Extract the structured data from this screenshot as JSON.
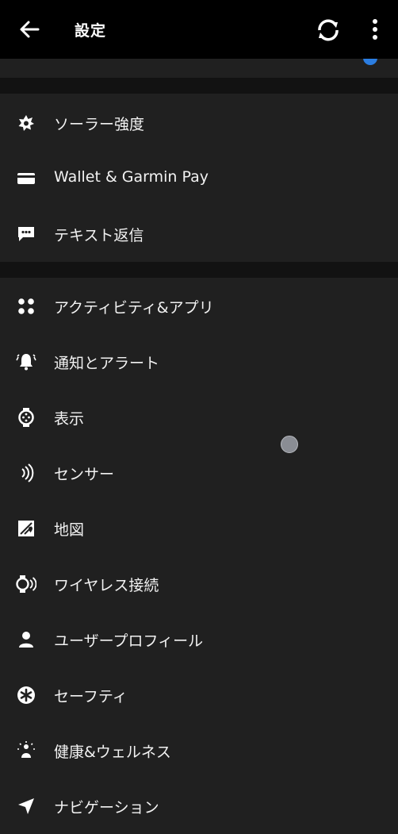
{
  "header": {
    "title": "設定",
    "icons": [
      "back-arrow-icon",
      "sync-icon",
      "more-vert-icon"
    ]
  },
  "section1": [
    {
      "label": "ソーラー強度",
      "icon": "solar-icon"
    },
    {
      "label": "Wallet & Garmin Pay",
      "icon": "wallet-icon"
    },
    {
      "label": "テキスト返信",
      "icon": "message-icon"
    }
  ],
  "section2": [
    {
      "label": "アクティビティ&アプリ",
      "icon": "activities-icon"
    },
    {
      "label": "通知とアラート",
      "icon": "bell-icon"
    },
    {
      "label": "表示",
      "icon": "watch-face-icon"
    },
    {
      "label": "センサー",
      "icon": "sensor-icon"
    },
    {
      "label": "地図",
      "icon": "map-icon"
    },
    {
      "label": "ワイヤレス接続",
      "icon": "wireless-watch-icon"
    },
    {
      "label": "ユーザープロフィール",
      "icon": "user-icon"
    },
    {
      "label": "セーフティ",
      "icon": "safety-icon"
    },
    {
      "label": "健康&ウェルネス",
      "icon": "wellness-icon"
    },
    {
      "label": "ナビゲーション",
      "icon": "navigation-icon"
    }
  ],
  "colors": {
    "appbar": "#000000",
    "background": "#202020",
    "divider": "#121212",
    "accent": "#2b7de1"
  }
}
